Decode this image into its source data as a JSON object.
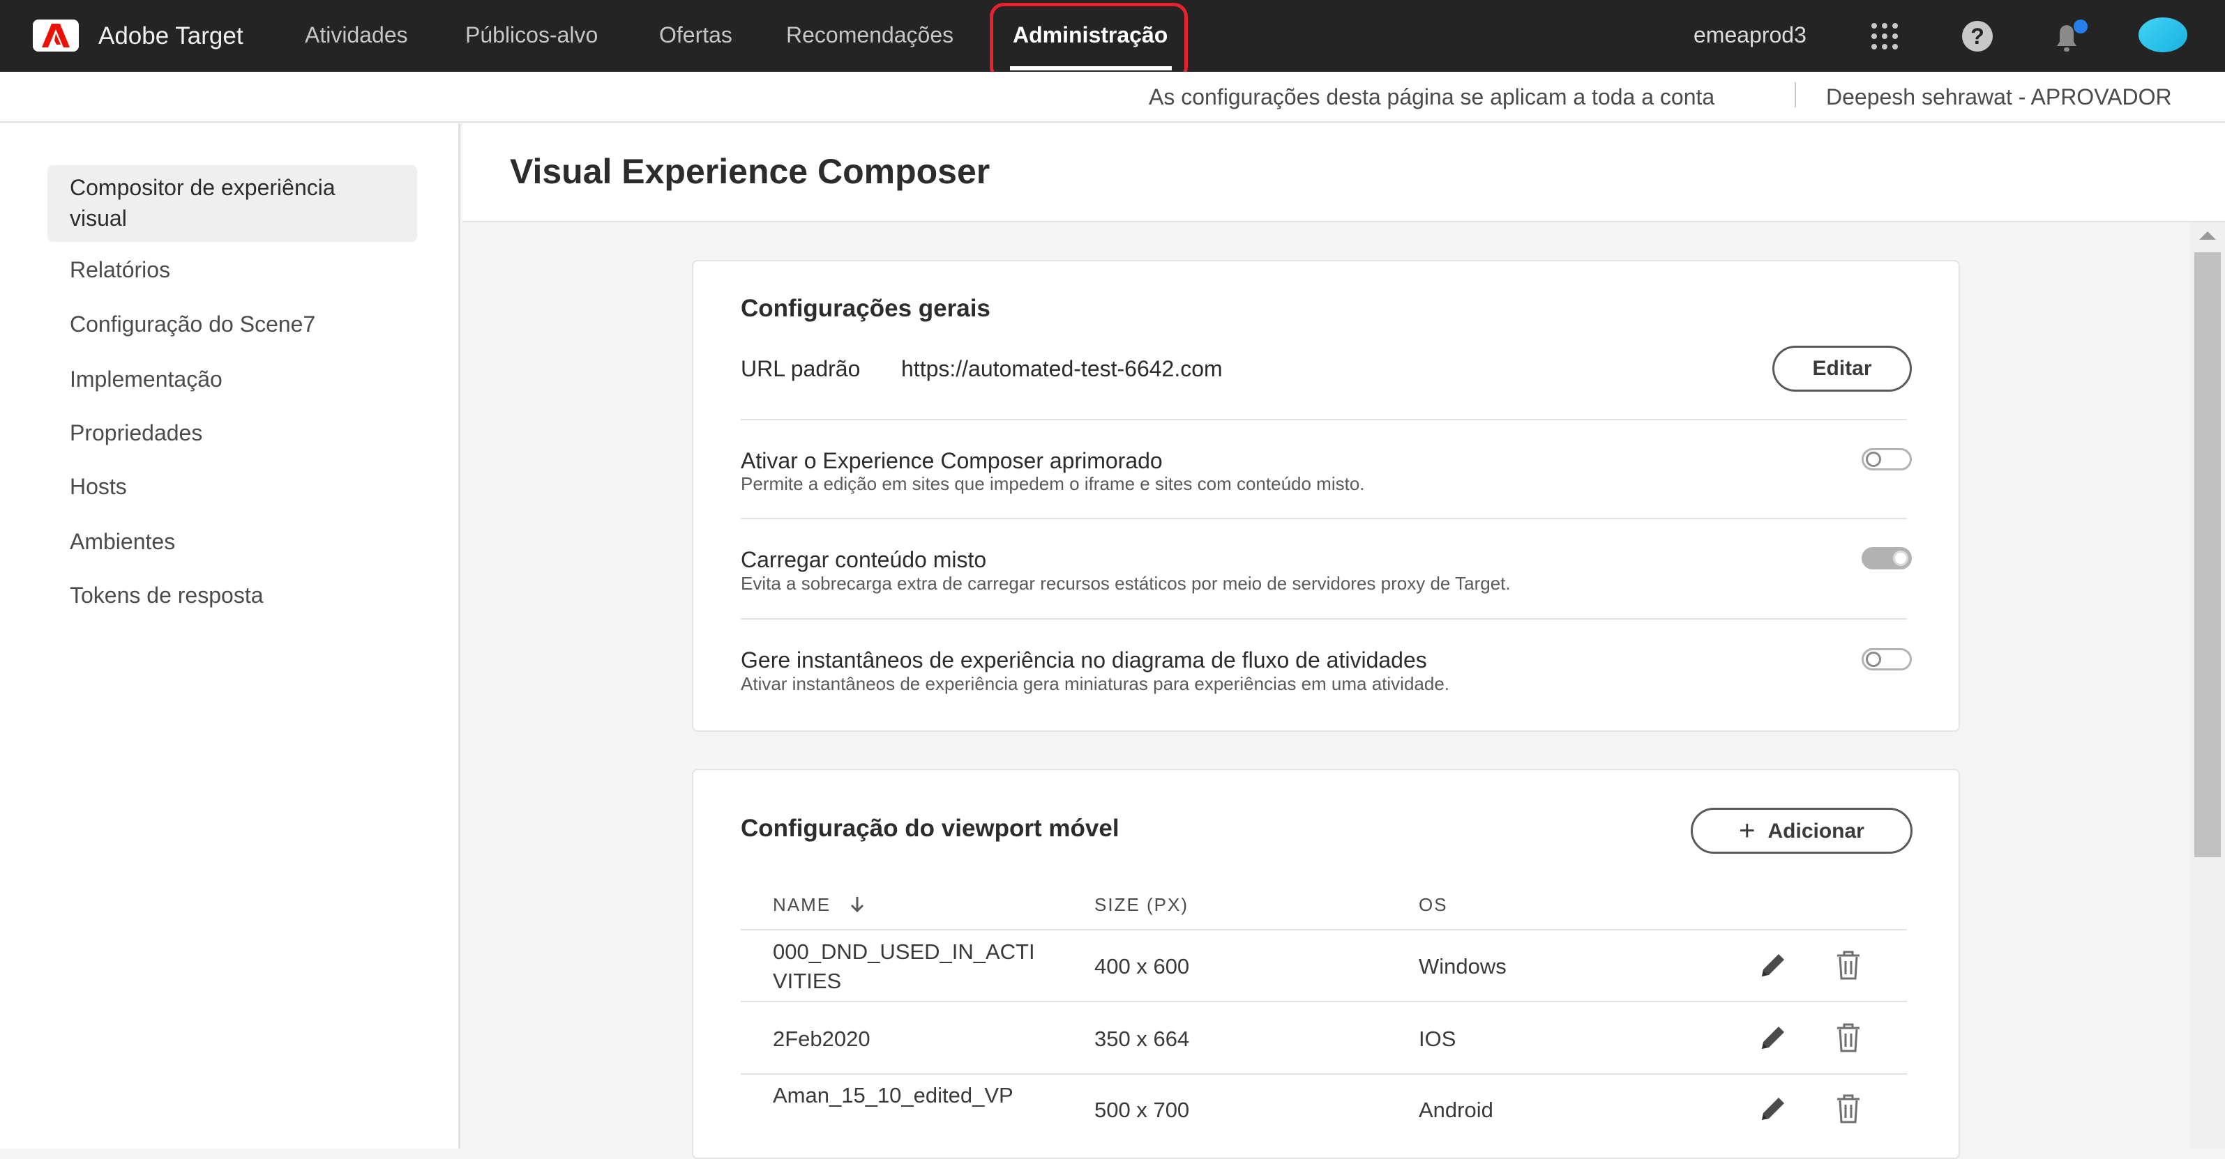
{
  "topnav": {
    "brand": "Adobe Target",
    "items": [
      "Atividades",
      "Públicos-alvo",
      "Ofertas",
      "Recomendações",
      "Administração"
    ],
    "org": "emeaprod3"
  },
  "subheader": {
    "scope_text": "As configurações desta página se aplicam a toda a conta",
    "user_text": "Deepesh sehrawat - APROVADOR"
  },
  "sidebar": {
    "active_item": "Compositor de experiência visual",
    "items": [
      "Relatórios",
      "Configuração do Scene7",
      "Implementação",
      "Propriedades",
      "Hosts",
      "Ambientes",
      "Tokens de resposta"
    ]
  },
  "page": {
    "title": "Visual Experience Composer"
  },
  "general_settings": {
    "title": "Configurações gerais",
    "url_label": "URL padrão",
    "url_value": "https://automated-test-6642.com",
    "edit_button": "Editar",
    "settings": [
      {
        "label": "Ativar o Experience Composer aprimorado",
        "description": "Permite a edição em sites que impedem o iframe e sites com conteúdo misto.",
        "enabled": false
      },
      {
        "label": "Carregar conteúdo misto",
        "description": "Evita a sobrecarga extra de carregar recursos estáticos por meio de servidores proxy de Target.",
        "enabled": true
      },
      {
        "label": "Gere instantâneos de experiência no diagrama de fluxo de atividades",
        "description": "Ativar instantâneos de experiência gera miniaturas para experiências em uma atividade.",
        "enabled": false
      }
    ]
  },
  "viewport_settings": {
    "title": "Configuração do viewport móvel",
    "add_button": "Adicionar",
    "columns": [
      "NAME",
      "SIZE (PX)",
      "OS"
    ],
    "rows": [
      {
        "name": "000_DND_USED_IN_ACTIVITIES",
        "size": "400 x 600",
        "os": "Windows"
      },
      {
        "name": "2Feb2020",
        "size": "350 x 664",
        "os": "IOS"
      },
      {
        "name": "Aman_15_10_edited_VP",
        "size": "500 x 700",
        "os": "Android"
      }
    ]
  },
  "colors": {
    "nav_bg": "#242424",
    "highlight": "#e4232f",
    "adobe_red": "#eb1000",
    "avatar": "#2ec4ec",
    "notification_dot": "#2680eb"
  },
  "icons": [
    "adobe-logo-icon",
    "apps-grid-icon",
    "help-icon",
    "bell-icon",
    "sort-down-icon",
    "plus-icon",
    "pencil-icon",
    "trash-icon"
  ]
}
